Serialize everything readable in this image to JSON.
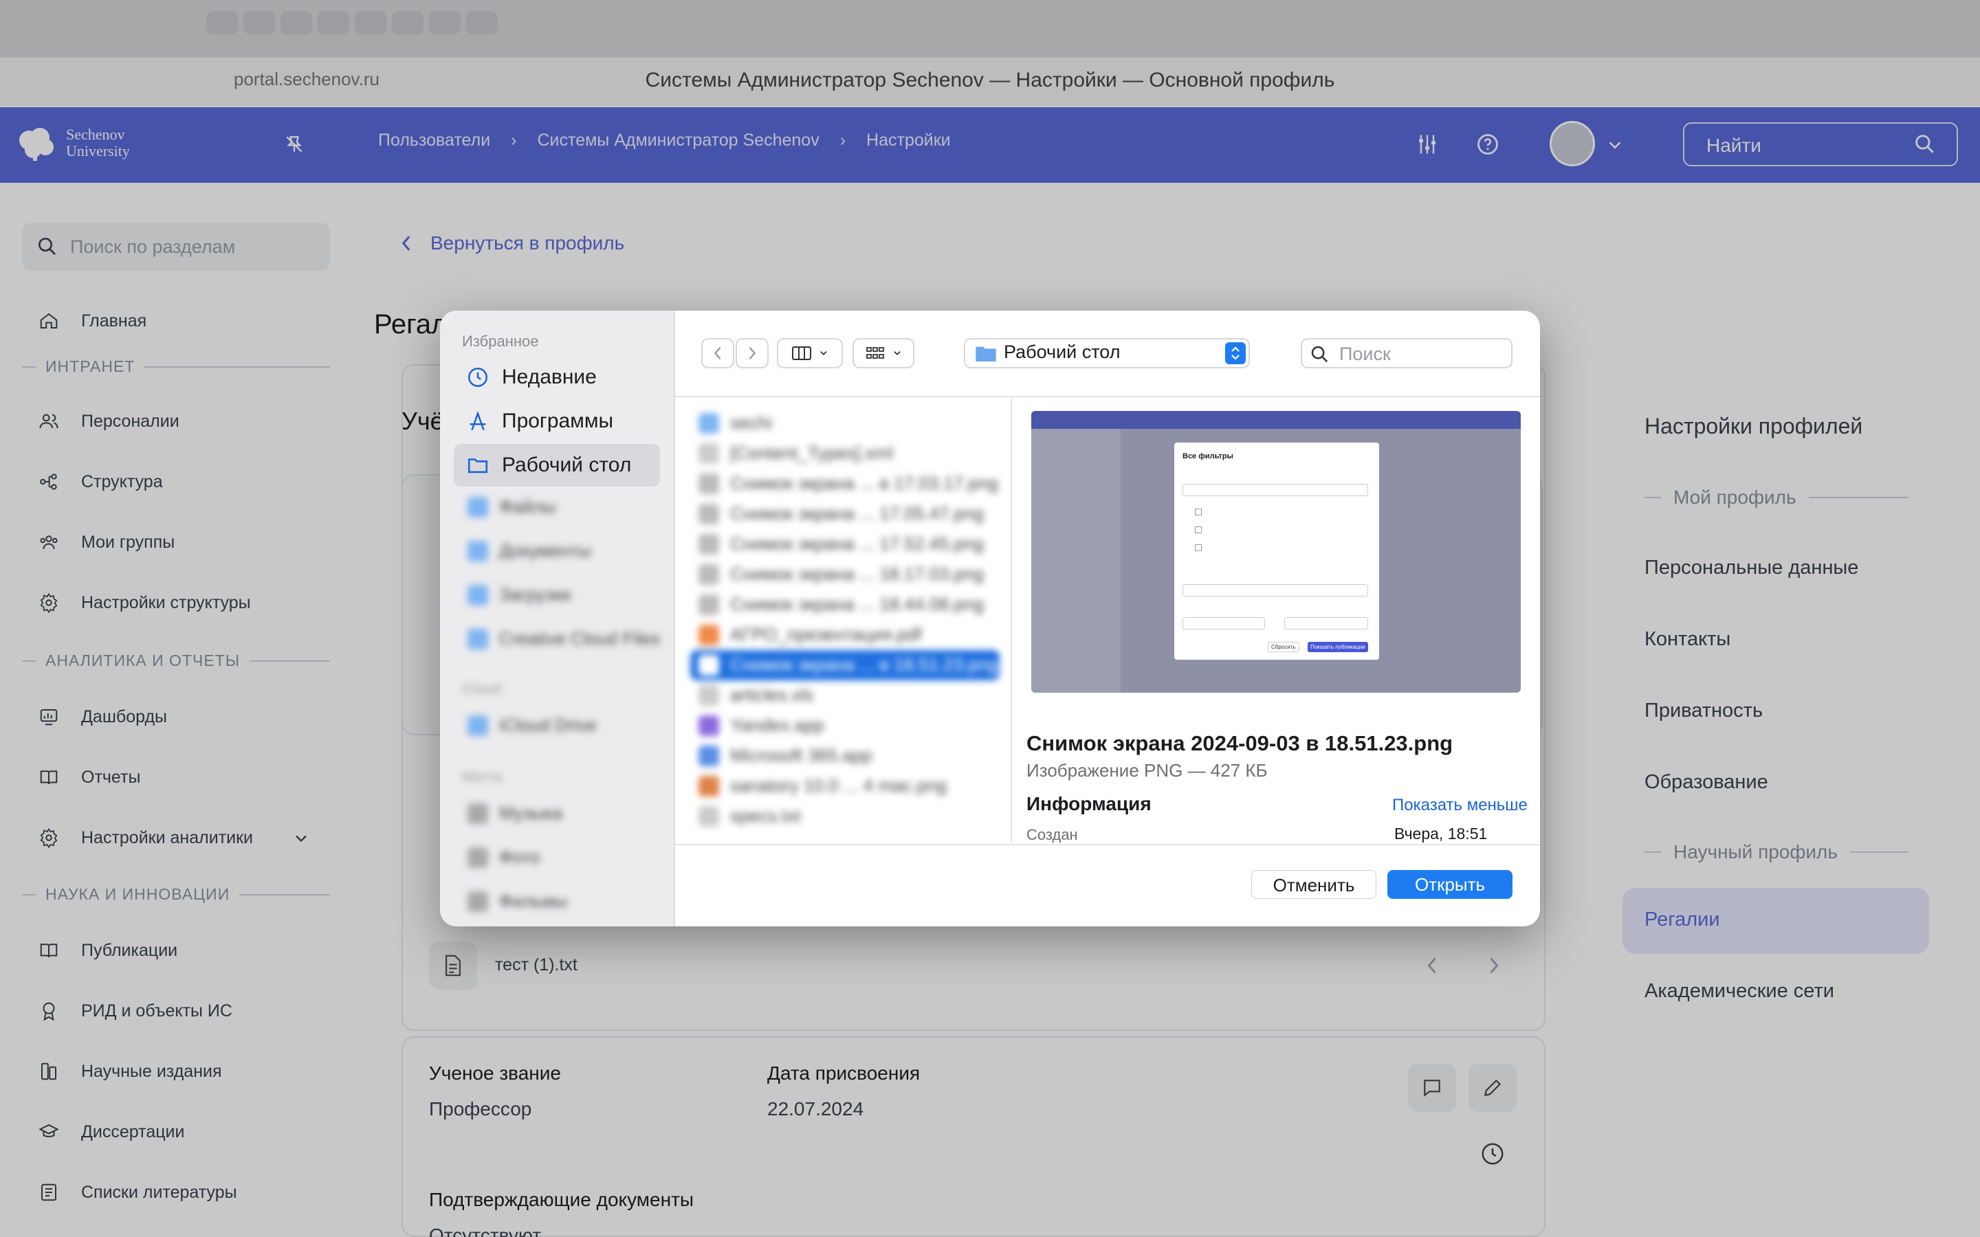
{
  "browser": {
    "window_title": "Системы Администратор Sechenov — Настройки — Основной профиль",
    "url": "portal.sechenov.ru"
  },
  "header": {
    "logo_line1": "Sechenov",
    "logo_line2": "University",
    "breadcrumb": [
      "Пользователи",
      "Системы Администратор Sechenov",
      "Настройки"
    ],
    "search_placeholder": "Найти",
    "accent_color": "#5a6ad9"
  },
  "sidebar": {
    "search_placeholder": "Поиск по разделам",
    "home": "Главная",
    "sections": [
      {
        "title": "ИНТРАНЕТ",
        "items": [
          "Персоналии",
          "Структура",
          "Мои группы",
          "Настройки структуры"
        ]
      },
      {
        "title": "АНАЛИТИКА И ОТЧЕТЫ",
        "items": [
          "Дашборды",
          "Отчеты",
          "Настройки аналитики"
        ]
      },
      {
        "title": "НАУКА И ИННОВАЦИИ",
        "items": [
          "Публикации",
          "РИД и объекты ИС",
          "Научные издания",
          "Диссертации",
          "Списки литературы"
        ]
      }
    ]
  },
  "main": {
    "back_link": "Вернуться в профиль",
    "page_title": "Регалии",
    "section_title": "Учёные степени",
    "attachment_file": "тест (1).txt",
    "record": {
      "title_label": "Ученое звание",
      "title_value": "Профессор",
      "date_label": "Дата присвоения",
      "date_value": "22.07.2024",
      "docs_label": "Подтверждающие документы",
      "docs_value": "Отсутствуют"
    }
  },
  "right_panel": {
    "title": "Настройки профилей",
    "section_my": "Мой профиль",
    "items_my": [
      "Персональные данные",
      "Контакты",
      "Приватность",
      "Образование"
    ],
    "section_sci": "Научный профиль",
    "items_sci": [
      "Регалии",
      "Академические сети"
    ],
    "active_item": "Регалии"
  },
  "dialog": {
    "favorites_header": "Избранное",
    "favorites": [
      "Недавние",
      "Программы",
      "Рабочий стол"
    ],
    "blurred_side": [
      "Файлы",
      "Документы",
      "Загрузки",
      "Creative Cloud Files",
      "iCloud",
      "iCloud Drive",
      "Места",
      "Музыка",
      "Фото",
      "Фильмы"
    ],
    "location": "Рабочий стол",
    "search_placeholder": "Поиск",
    "files_blurred": [
      "sechi",
      "[Content_Types].xml",
      "Снимок экрана ... в 17.03.17.png",
      "Снимок экрана ... 17.05.47.png",
      "Снимок экрана ... 17.52.45.png",
      "Снимок экрана ... 18.17.03.png",
      "Снимок экрана ... 18.44.08.png",
      "АГРО_презентация.pdf",
      "Снимок экрана ... в 18.51.23.png",
      "articles.xls",
      "Yandex.app",
      "Microsoft 365.app",
      "sanatory 10.0 ... 4 mac.png",
      "specs.txt"
    ],
    "preview": {
      "file_name": "Снимок экрана 2024-09-03 в 18.51.23.png",
      "file_kind": "Изображение PNG — 427 КБ",
      "info_header": "Информация",
      "show_less": "Показать меньше",
      "created_label": "Создан",
      "created_value": "Вчера, 18:51",
      "thumb_title": "Все фильтры",
      "thumb_apply": "Показать публикации",
      "thumb_reset": "Сбросить"
    },
    "cancel_label": "Отменить",
    "open_label": "Открыть"
  }
}
